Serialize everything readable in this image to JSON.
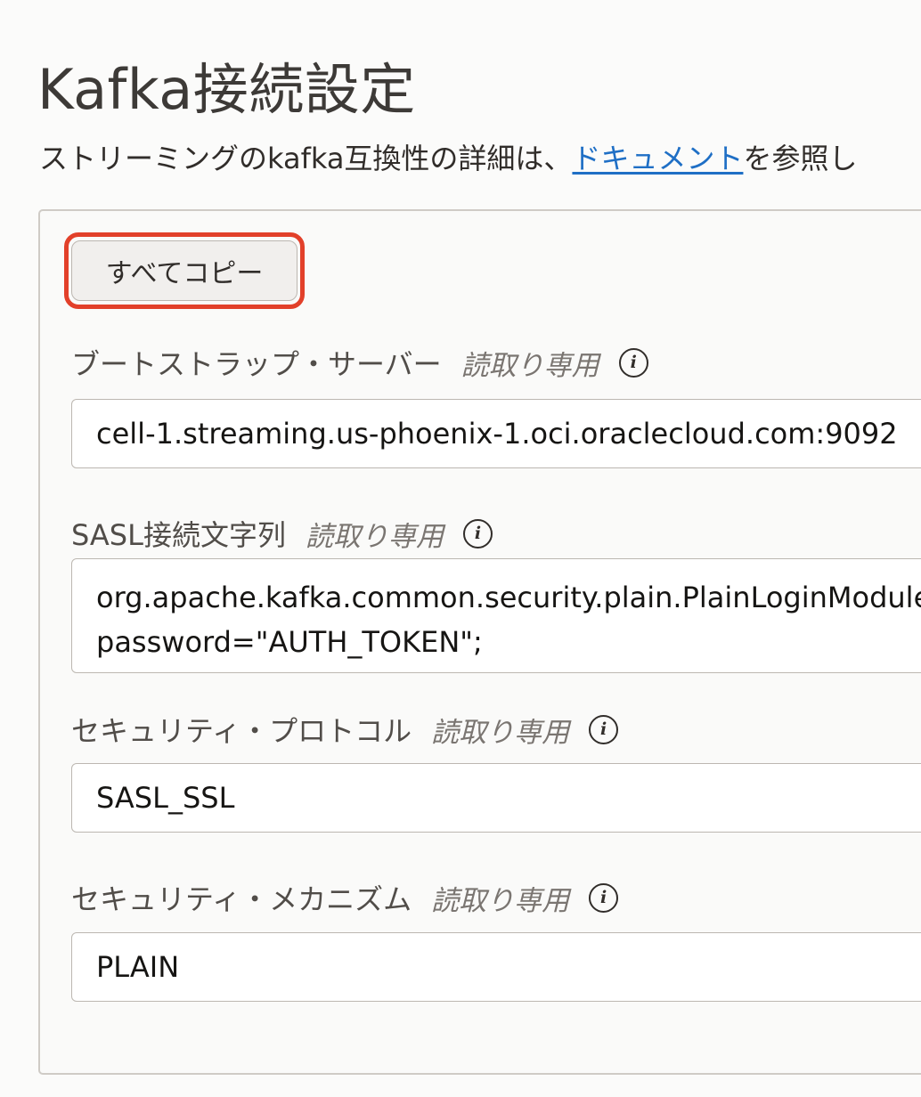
{
  "page": {
    "title": "Kafka接続設定",
    "intro_before": "ストリーミングのkafka互換性の詳細は、",
    "intro_link": "ドキュメント",
    "intro_after": "を参照し"
  },
  "actions": {
    "copy_all_label": "すべてコピー"
  },
  "read_only_label": "読取り専用",
  "fields": {
    "bootstrap": {
      "label": "ブートストラップ・サーバー",
      "value": "cell-1.streaming.us-phoenix-1.oci.oraclecloud.com:9092"
    },
    "sasl": {
      "label": "SASL接続文字列",
      "value_line1": "org.apache.kafka.common.security.plain.PlainLoginModule",
      "value_line2": "password=\"AUTH_TOKEN\";"
    },
    "protocol": {
      "label": "セキュリティ・プロトコル",
      "value": "SASL_SSL"
    },
    "mechanism": {
      "label": "セキュリティ・メカニズム",
      "value": "PLAIN"
    }
  },
  "icons": {
    "info": "info-icon"
  },
  "colors": {
    "link": "#1f6fc5",
    "highlight": "#e2402a",
    "text": "#312d2a"
  }
}
